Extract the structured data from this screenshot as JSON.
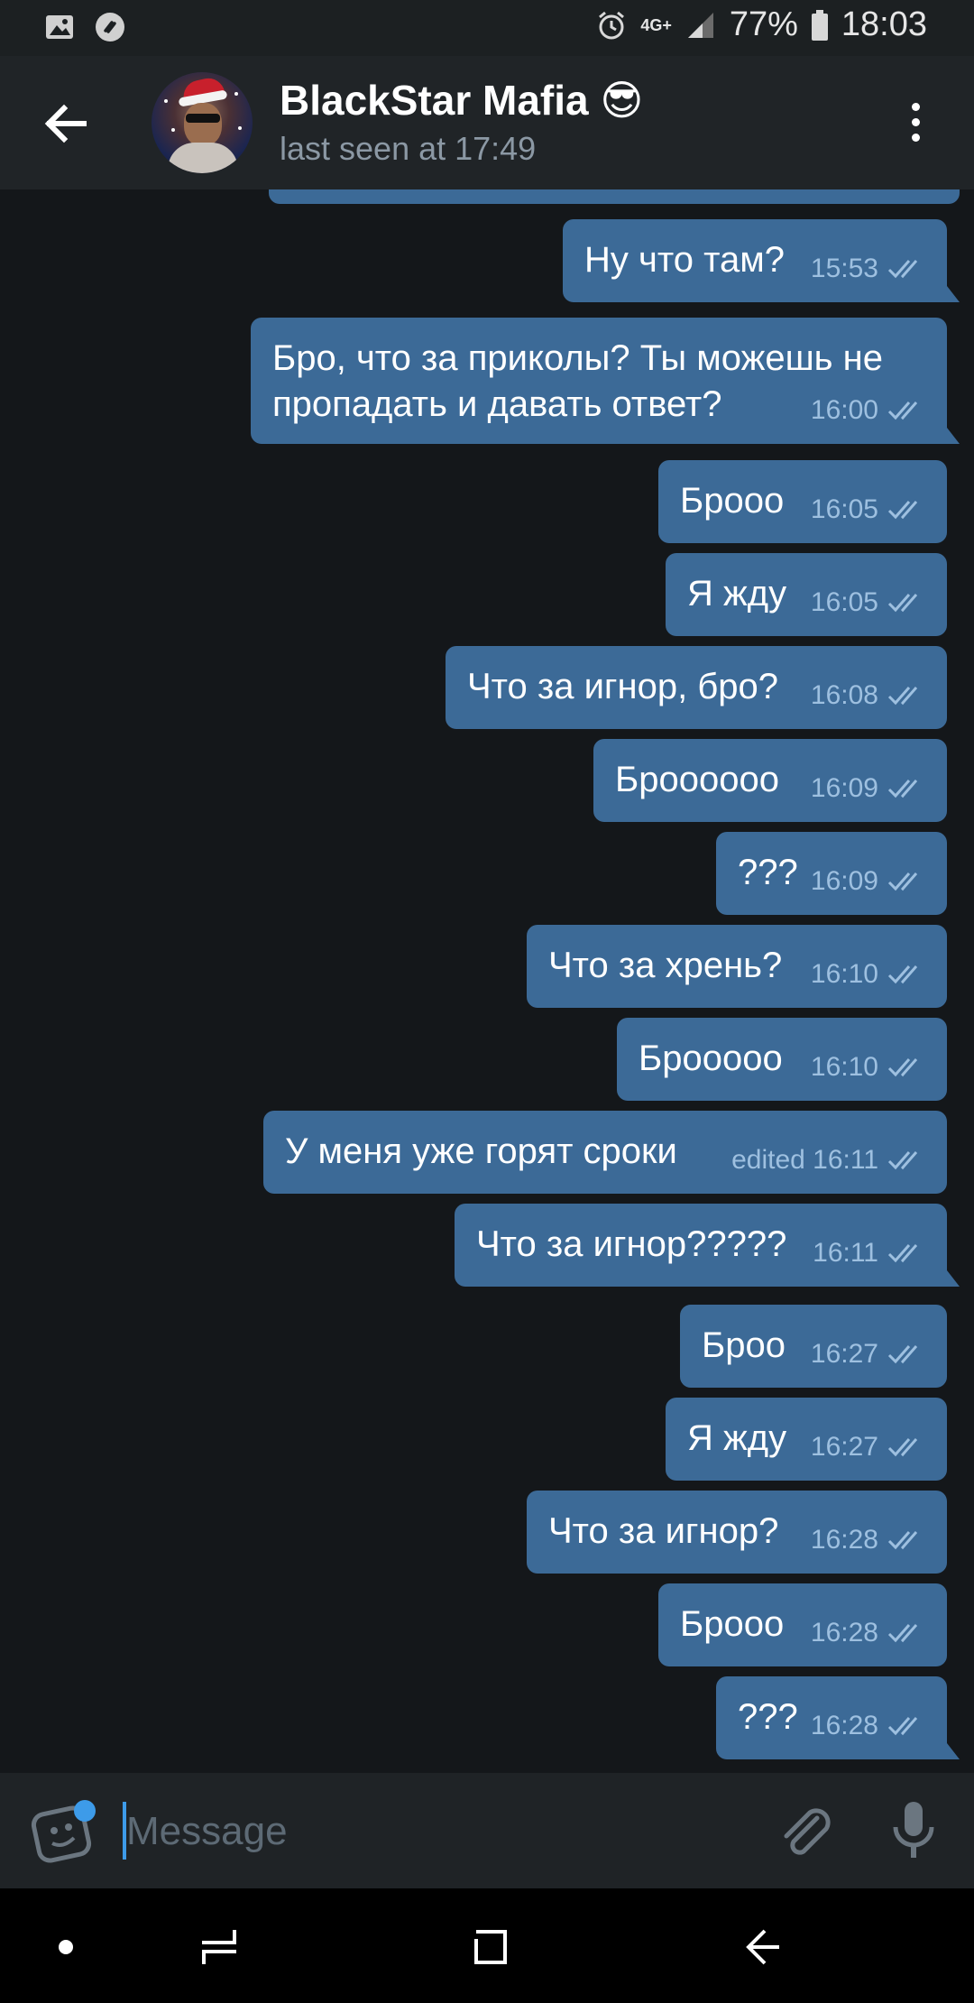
{
  "status_bar": {
    "network": "4G+",
    "battery": "77%",
    "time": "18:03"
  },
  "header": {
    "title": "BlackStar Mafia 😎",
    "subtitle": "last seen at 17:49"
  },
  "messages": [
    {
      "text": "Ну что там?",
      "time": "15:53"
    },
    {
      "text": "Бро, что за приколы? Ты можешь не\nпропадать и давать ответ?",
      "time": "16:00"
    },
    {
      "text": "Бpooo",
      "time": "16:05"
    },
    {
      "text": "Я жду",
      "time": "16:05"
    },
    {
      "text": "Что за игнор, бро?",
      "time": "16:08"
    },
    {
      "text": "Броооооо",
      "time": "16:09"
    },
    {
      "text": "???",
      "time": "16:09"
    },
    {
      "text": "Что за хрень?",
      "time": "16:10"
    },
    {
      "text": "Брооооо",
      "time": "16:10"
    },
    {
      "text": "У меня уже горят сроки",
      "time": "edited 16:11"
    },
    {
      "text": "Что за игнор?????",
      "time": "16:11"
    },
    {
      "text": "Броо",
      "time": "16:27"
    },
    {
      "text": "Я жду",
      "time": "16:27"
    },
    {
      "text": "Что за игнор?",
      "time": "16:28"
    },
    {
      "text": "Бpooo",
      "time": "16:28"
    },
    {
      "text": "???",
      "time": "16:28"
    }
  ],
  "input": {
    "placeholder": "Message",
    "value": ""
  },
  "colors": {
    "bubble_out": "#3c6a97",
    "accent": "#3d9be9",
    "background": "#14171a"
  }
}
